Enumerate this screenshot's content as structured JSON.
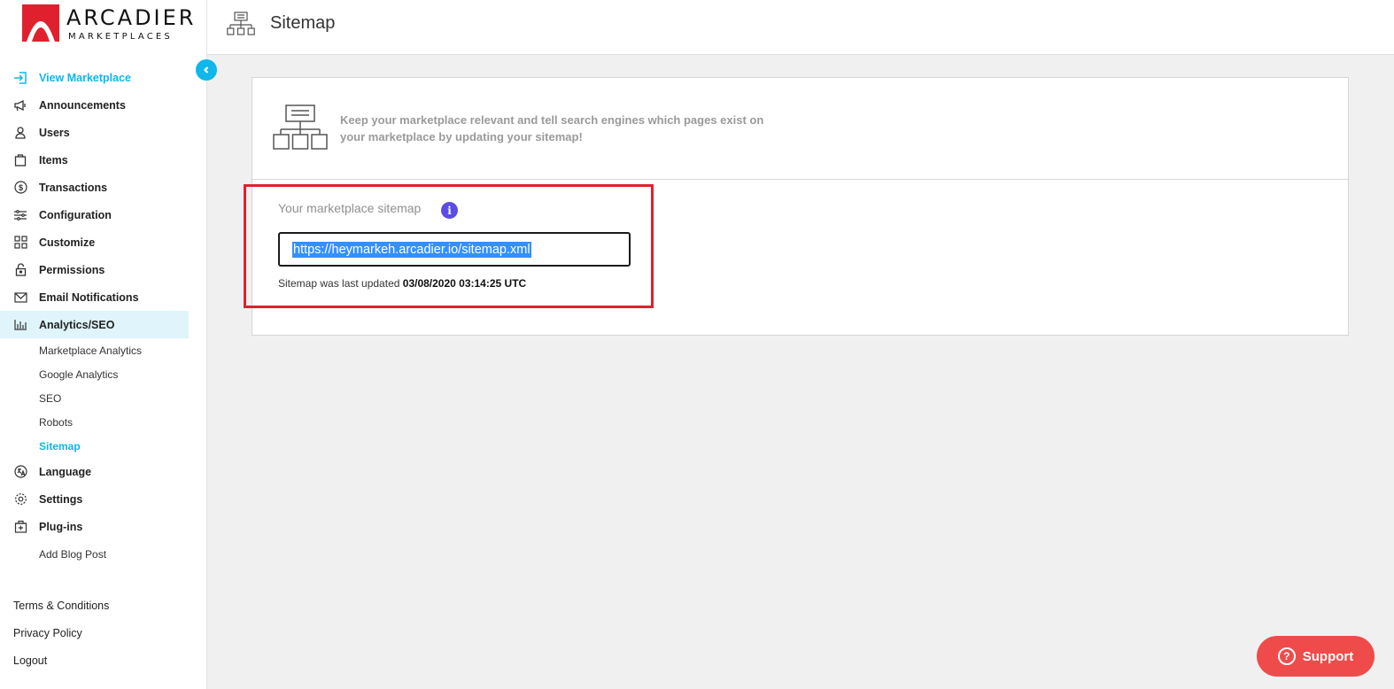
{
  "brand": {
    "name": "ARCADIER",
    "sub": "MARKETPLACES",
    "accent": "#e0212d"
  },
  "header": {
    "title": "Sitemap",
    "icon": "sitemap-icon"
  },
  "sidebar": {
    "items": [
      {
        "label": "View Marketplace",
        "icon": "enter-icon"
      },
      {
        "label": "Announcements",
        "icon": "megaphone-icon"
      },
      {
        "label": "Users",
        "icon": "user-icon"
      },
      {
        "label": "Items",
        "icon": "bag-icon"
      },
      {
        "label": "Transactions",
        "icon": "dollar-icon"
      },
      {
        "label": "Configuration",
        "icon": "sliders-icon"
      },
      {
        "label": "Customize",
        "icon": "grid-icon"
      },
      {
        "label": "Permissions",
        "icon": "lock-icon"
      },
      {
        "label": "Email Notifications",
        "icon": "mail-icon"
      },
      {
        "label": "Analytics/SEO",
        "icon": "chart-icon"
      }
    ],
    "subitems": [
      "Marketplace Analytics",
      "Google Analytics",
      "SEO",
      "Robots",
      "Sitemap"
    ],
    "items2": [
      {
        "label": "Language",
        "icon": "language-icon"
      },
      {
        "label": "Settings",
        "icon": "gear-icon"
      },
      {
        "label": "Plug-ins",
        "icon": "plugin-icon"
      }
    ],
    "extra": "Add Blog Post",
    "footer": [
      "Terms & Conditions",
      "Privacy Policy",
      "Logout"
    ]
  },
  "card": {
    "description": "Keep your marketplace relevant and tell search engines which pages exist on your marketplace by updating your sitemap!",
    "field_label": "Your marketplace sitemap",
    "url": "https://heymarkeh.arcadier.io/sitemap.xml",
    "updated_prefix": "Sitemap was last updated",
    "updated_value": "03/08/2020 03:14:25 UTC"
  },
  "support": {
    "label": "Support",
    "color": "#f04b4b"
  },
  "colors": {
    "accent": "#0fb7ea",
    "highlight": "#e0212d"
  }
}
